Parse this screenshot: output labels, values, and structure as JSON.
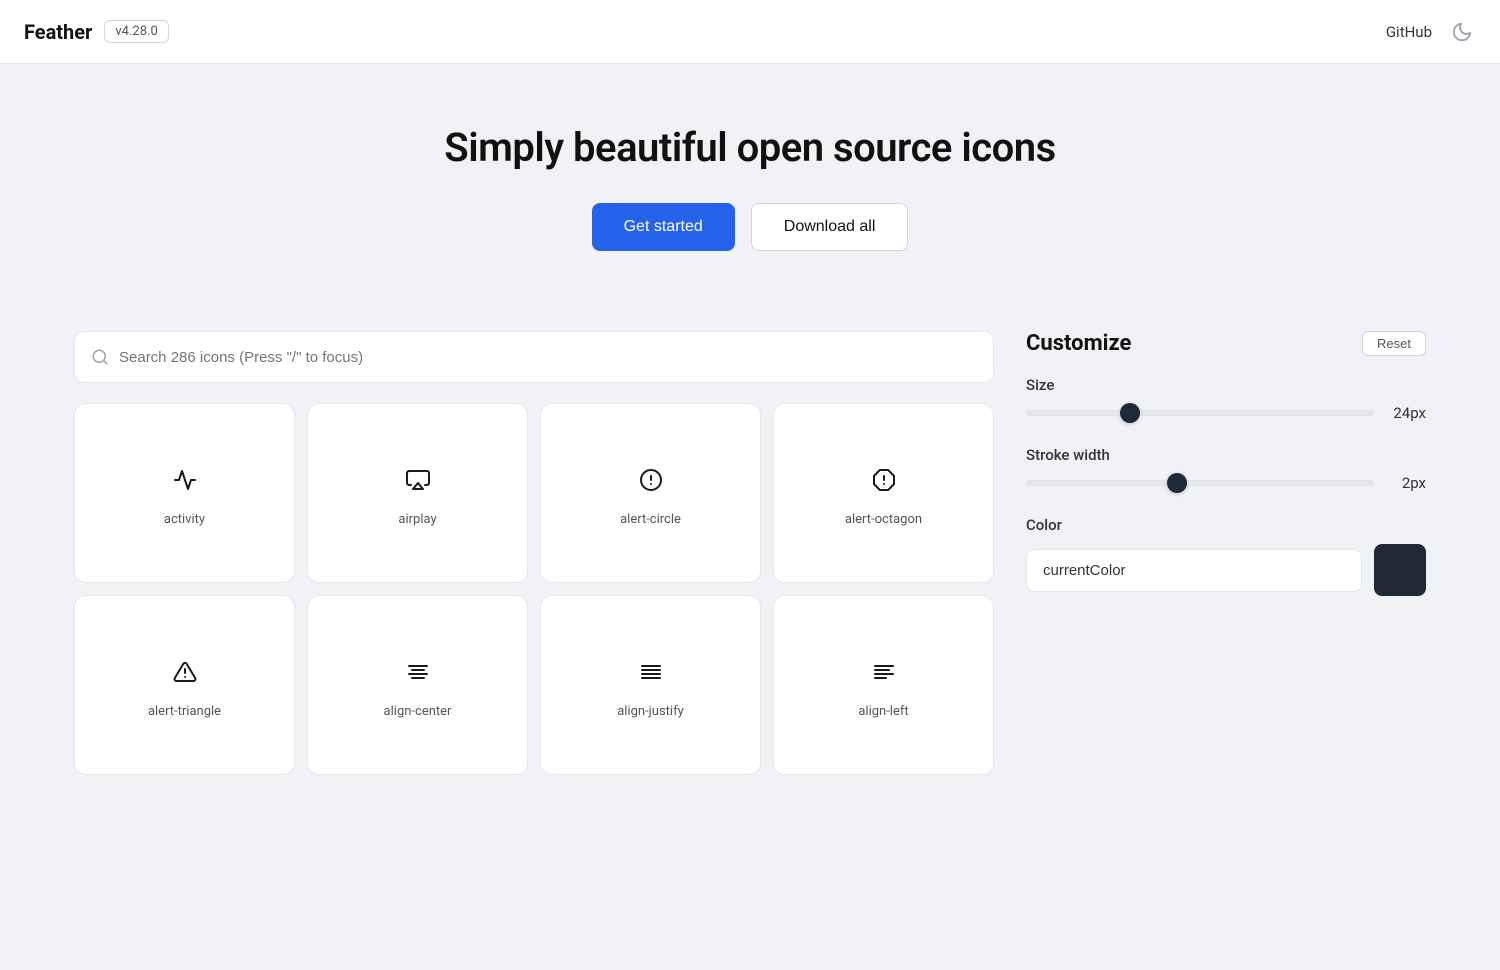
{
  "header": {
    "logo": "Feather",
    "version": "v4.28.0",
    "github_label": "GitHub",
    "moon_icon": "🌙"
  },
  "hero": {
    "title": "Simply beautiful open source icons",
    "get_started_label": "Get started",
    "download_all_label": "Download all"
  },
  "search": {
    "placeholder": "Search 286 icons (Press \"/\" to focus)"
  },
  "customize": {
    "title": "Customize",
    "reset_label": "Reset",
    "size_label": "Size",
    "size_value": "24px",
    "size_percent": 28,
    "stroke_label": "Stroke width",
    "stroke_value": "2px",
    "stroke_percent": 50,
    "color_label": "Color",
    "color_value": "currentColor",
    "color_swatch": "#1f2937"
  },
  "icons": [
    {
      "name": "activity",
      "row": 0
    },
    {
      "name": "airplay",
      "row": 0
    },
    {
      "name": "alert-circle",
      "row": 0
    },
    {
      "name": "alert-octagon",
      "row": 0
    },
    {
      "name": "alert-triangle",
      "row": 1
    },
    {
      "name": "align-center",
      "row": 1
    },
    {
      "name": "align-justify",
      "row": 1
    },
    {
      "name": "align-left",
      "row": 1
    }
  ]
}
